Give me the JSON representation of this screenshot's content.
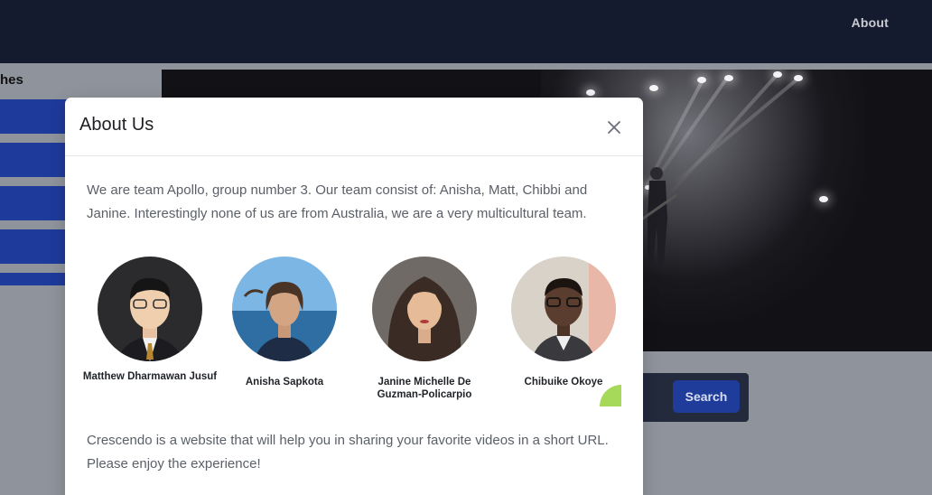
{
  "navbar": {
    "about_label": "About"
  },
  "sidebar": {
    "title_partial": "hes",
    "buttons": 4
  },
  "search": {
    "button_label": "Search"
  },
  "modal": {
    "title": "About Us",
    "close_icon": "close-icon",
    "intro": "We are team Apollo, group number 3. Our team consist of: Anisha, Matt, Chibbi and Janine. Interestingly none of us are from Australia, we are a very multicultural team.",
    "members": [
      {
        "name": "Matthew Dharmawan Jusuf"
      },
      {
        "name": "Anisha Sapkota"
      },
      {
        "name": "Janine Michelle De Guzman-Policarpio"
      },
      {
        "name": "Chibuike Okoye"
      }
    ],
    "outro": "Crescendo is a website that will help you in sharing your favorite videos in a short URL. Please enjoy the experience!"
  },
  "colors": {
    "navbar_bg": "#151b2e",
    "accent_blue": "#1e3a9a",
    "overlay": "#8f939b",
    "deco_green": "#a6d95a"
  }
}
